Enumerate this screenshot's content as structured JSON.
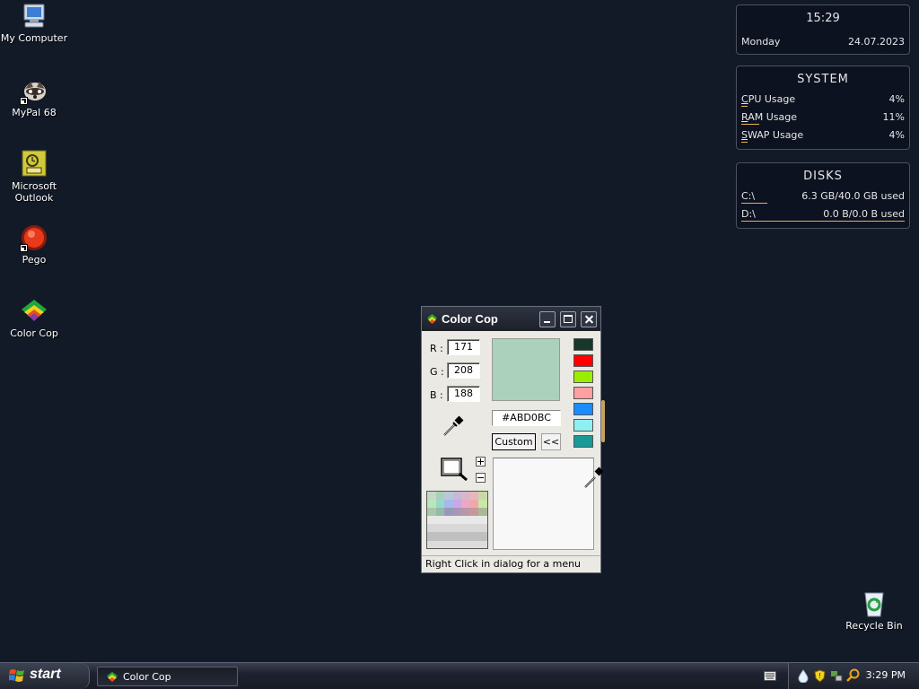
{
  "desktop": {
    "icons": [
      {
        "label": "My Computer",
        "icon": "computer-icon"
      },
      {
        "label": "MyPal 68",
        "icon": "mypal-raccoon-icon"
      },
      {
        "label": "Microsoft Outlook",
        "icon": "outlook-icon"
      },
      {
        "label": "Pego",
        "icon": "pego-icon"
      },
      {
        "label": "Color Cop",
        "icon": "color-cop-icon"
      },
      {
        "label": "Recycle Bin",
        "icon": "recycle-bin-icon"
      }
    ]
  },
  "gadgets": {
    "clock": {
      "time": "15:29",
      "day": "Monday",
      "date": "24.07.2023"
    },
    "system": {
      "title": "SYSTEM",
      "rows": [
        {
          "label": "CPU Usage",
          "value": "4%",
          "accel": "C",
          "rest": "PU Usage",
          "fraction": 0.04
        },
        {
          "label": "RAM Usage",
          "value": "11%",
          "accel": "R",
          "rest": "AM Usage",
          "fraction": 0.11
        },
        {
          "label": "SWAP Usage",
          "value": "4%",
          "accel": "S",
          "rest": "WAP Usage",
          "fraction": 0.04
        }
      ]
    },
    "disks": {
      "title": "DISKS",
      "rows": [
        {
          "label": "C:\\",
          "value": "6.3 GB/40.0 GB used",
          "fraction": 0.16
        },
        {
          "label": "D:\\",
          "value": "0.0 B/0.0 B used",
          "fraction": 1.0
        }
      ]
    }
  },
  "window": {
    "title": "Color Cop",
    "r_label": "R :",
    "g_label": "G :",
    "b_label": "B :",
    "r": "171",
    "g": "208",
    "b": "188",
    "hex": "#ABD0BC",
    "current_color": "#abd0bc",
    "custom_label": "Custom",
    "expand_label": "<<",
    "palette": [
      "#17372a",
      "#ff0000",
      "#99ee00",
      "#ffa0a0",
      "#1a8cff",
      "#8ef0f0",
      "#1a9999"
    ],
    "status": "Right Click in dialog for a menu"
  },
  "taskbar": {
    "start_label": "start",
    "tasks": [
      {
        "label": "Color Cop"
      }
    ],
    "tray_icons": [
      "keyboard-icon",
      "water-drop-icon",
      "security-shield-icon",
      "network-icon",
      "search-icon"
    ],
    "clock": "3:29 PM"
  }
}
